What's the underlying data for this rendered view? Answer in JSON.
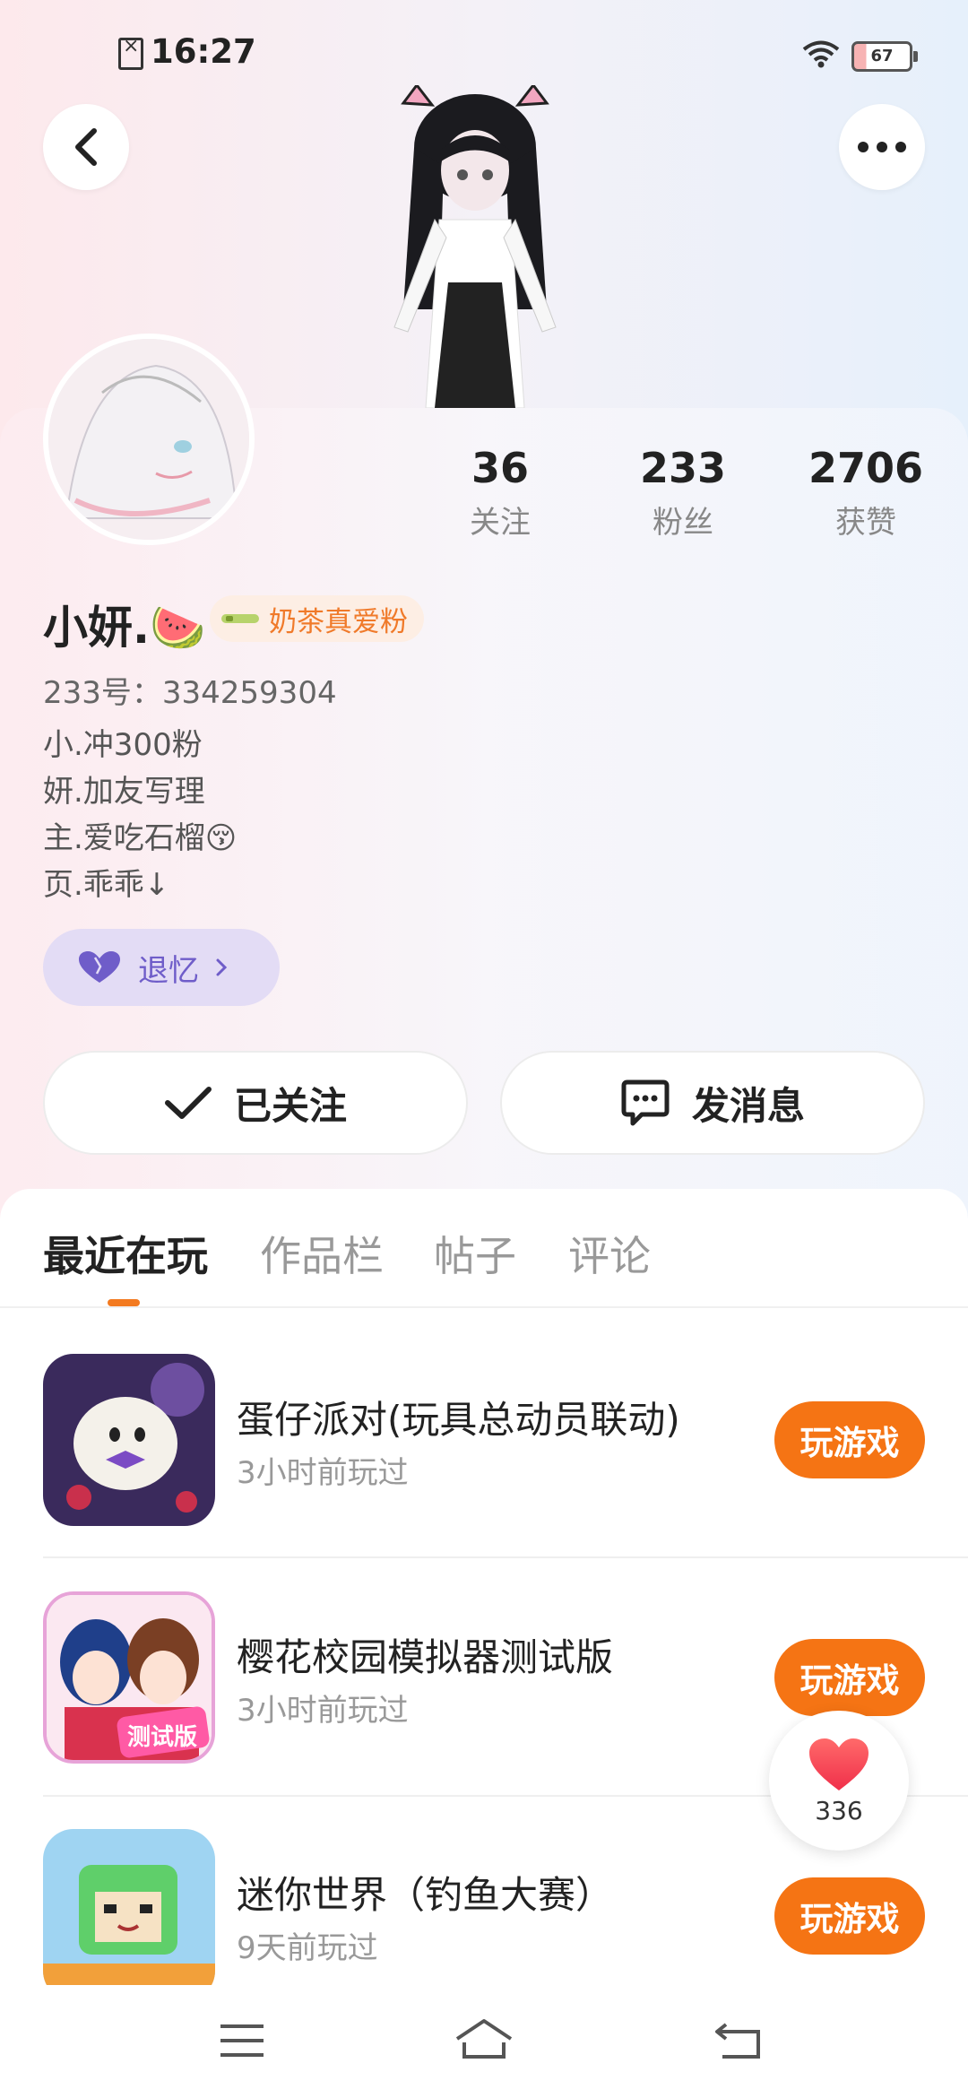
{
  "status_bar": {
    "time": "16:27",
    "battery": "67"
  },
  "profile": {
    "name": "小妍.🍉",
    "badge_text": "奶茶真爱粉",
    "uid_line": "233号：334259304",
    "bio_lines": [
      "小.冲300粉",
      "妍.加友写理",
      "主.爱吃石榴😚",
      "页.乖乖↓"
    ],
    "tag_label": "退忆",
    "stats": [
      {
        "value": "36",
        "label": "关注"
      },
      {
        "value": "233",
        "label": "粉丝"
      },
      {
        "value": "2706",
        "label": "获赞"
      }
    ]
  },
  "actions": {
    "follow_label": "已关注",
    "message_label": "发消息"
  },
  "tabs": [
    {
      "label": "最近在玩",
      "active": true
    },
    {
      "label": "作品栏",
      "active": false
    },
    {
      "label": "帖子",
      "active": false
    },
    {
      "label": "评论",
      "active": false
    }
  ],
  "games": [
    {
      "title": "蛋仔派对(玩具总动员联动)",
      "subtitle": "3小时前玩过",
      "button": "玩游戏",
      "icon": "eggy-party-icon"
    },
    {
      "title": "樱花校园模拟器测试版",
      "subtitle": "3小时前玩过",
      "button": "玩游戏",
      "icon": "sakura-school-icon",
      "icon_badge": "测试版"
    },
    {
      "title": "迷你世界（钓鱼大赛）",
      "subtitle": "9天前玩过",
      "button": "玩游戏",
      "icon": "mini-world-icon"
    }
  ],
  "like_button": {
    "count": "336"
  },
  "colors": {
    "accent": "#f57414",
    "tag_purple": "#6f5dc9",
    "badge_orange": "#f07a2a"
  }
}
